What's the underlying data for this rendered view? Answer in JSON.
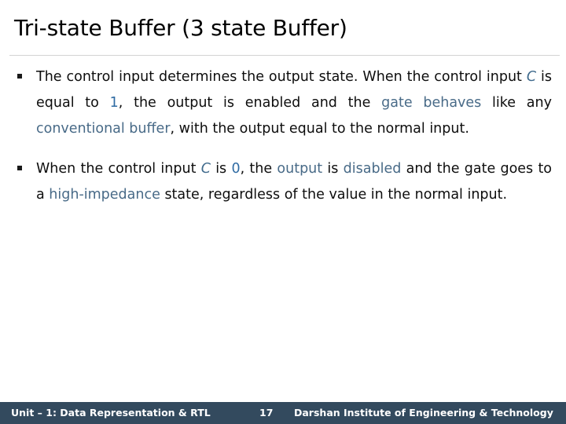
{
  "slide": {
    "title": "Tri-state Buffer (3 state Buffer)",
    "background_color": "#ffffff",
    "rule_color": "#d3d3d3"
  },
  "colors": {
    "highlight": "#486a87",
    "number": "#2f6ba3",
    "variable": "#3f6a8c",
    "footer_bar": "#334a5e",
    "footer_text": "#ffffff",
    "body_text": "#0d0d0d"
  },
  "bullets": [
    {
      "marker": "square-bullet",
      "segments": [
        {
          "text": "The control input determines the output state. When the control input ",
          "style": "normal"
        },
        {
          "text": "C",
          "style": "variable"
        },
        {
          "text": " is equal to ",
          "style": "normal"
        },
        {
          "text": "1",
          "style": "number"
        },
        {
          "text": ", the output is enabled and the ",
          "style": "normal"
        },
        {
          "text": "gate behaves",
          "style": "highlight"
        },
        {
          "text": " like any ",
          "style": "normal"
        },
        {
          "text": "conventional buffer",
          "style": "highlight"
        },
        {
          "text": ", with the output equal to the normal input.",
          "style": "normal"
        }
      ],
      "plain_text": "The control input determines the output state. When the control input C is equal to 1, the output is enabled and the gate behaves like any conventional buffer, with the output equal to the normal input."
    },
    {
      "marker": "square-bullet",
      "segments": [
        {
          "text": "When the control input ",
          "style": "normal"
        },
        {
          "text": "C",
          "style": "variable"
        },
        {
          "text": " is ",
          "style": "normal"
        },
        {
          "text": "0",
          "style": "number"
        },
        {
          "text": ", the ",
          "style": "normal"
        },
        {
          "text": "output",
          "style": "highlight"
        },
        {
          "text": " is ",
          "style": "normal"
        },
        {
          "text": "disabled",
          "style": "highlight"
        },
        {
          "text": " and the gate goes to a ",
          "style": "normal"
        },
        {
          "text": "high-impedance",
          "style": "highlight"
        },
        {
          "text": " state, regardless of the value in the normal input.",
          "style": "normal"
        }
      ],
      "plain_text": "When the control input C is 0, the output is disabled and the gate goes to a high-impedance state, regardless of the value in the normal input."
    }
  ],
  "footer": {
    "unit_label": "Unit – 1: Data Representation & RTL",
    "page_number": "17",
    "institute": "Darshan Institute of Engineering & Technology"
  }
}
